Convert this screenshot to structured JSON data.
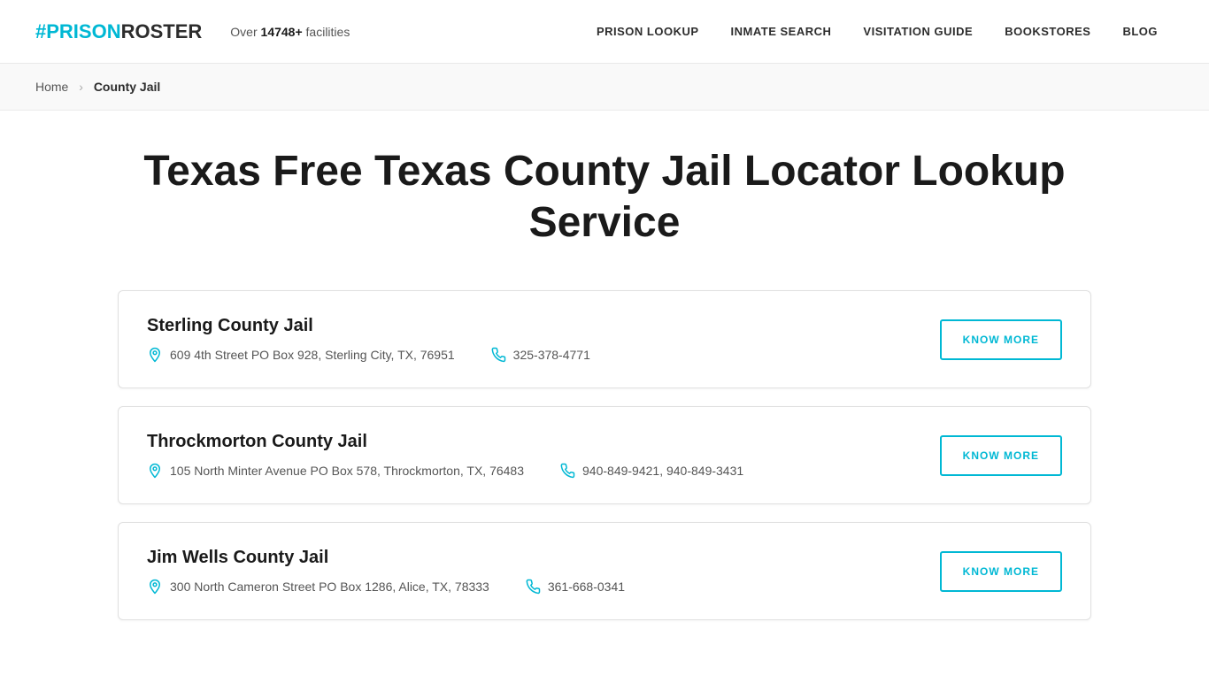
{
  "logo": {
    "hash": "#",
    "prison": "PRISON",
    "roster": "ROSTER"
  },
  "header": {
    "facilities_text": "Over ",
    "facilities_count": "14748+",
    "facilities_suffix": " facilities",
    "nav": [
      {
        "label": "PRISON LOOKUP",
        "id": "prison-lookup"
      },
      {
        "label": "INMATE SEARCH",
        "id": "inmate-search"
      },
      {
        "label": "VISITATION GUIDE",
        "id": "visitation-guide"
      },
      {
        "label": "BOOKSTORES",
        "id": "bookstores"
      },
      {
        "label": "BLOG",
        "id": "blog"
      }
    ]
  },
  "breadcrumb": {
    "home": "Home",
    "separator": "›",
    "current": "County Jail"
  },
  "page_title": "Texas Free Texas County Jail Locator Lookup Service",
  "jails": [
    {
      "name": "Sterling County Jail",
      "address": "609 4th Street PO Box 928, Sterling City, TX, 76951",
      "phone": "325-378-4771",
      "button_label": "KNOW MORE"
    },
    {
      "name": "Throckmorton County Jail",
      "address": "105 North Minter Avenue PO Box 578, Throckmorton, TX, 76483",
      "phone": "940-849-9421, 940-849-3431",
      "button_label": "KNOW MORE"
    },
    {
      "name": "Jim Wells County Jail",
      "address": "300 North Cameron Street PO Box 1286, Alice, TX, 78333",
      "phone": "361-668-0341",
      "button_label": "KNOW MORE"
    }
  ],
  "colors": {
    "accent": "#00b8d4"
  }
}
